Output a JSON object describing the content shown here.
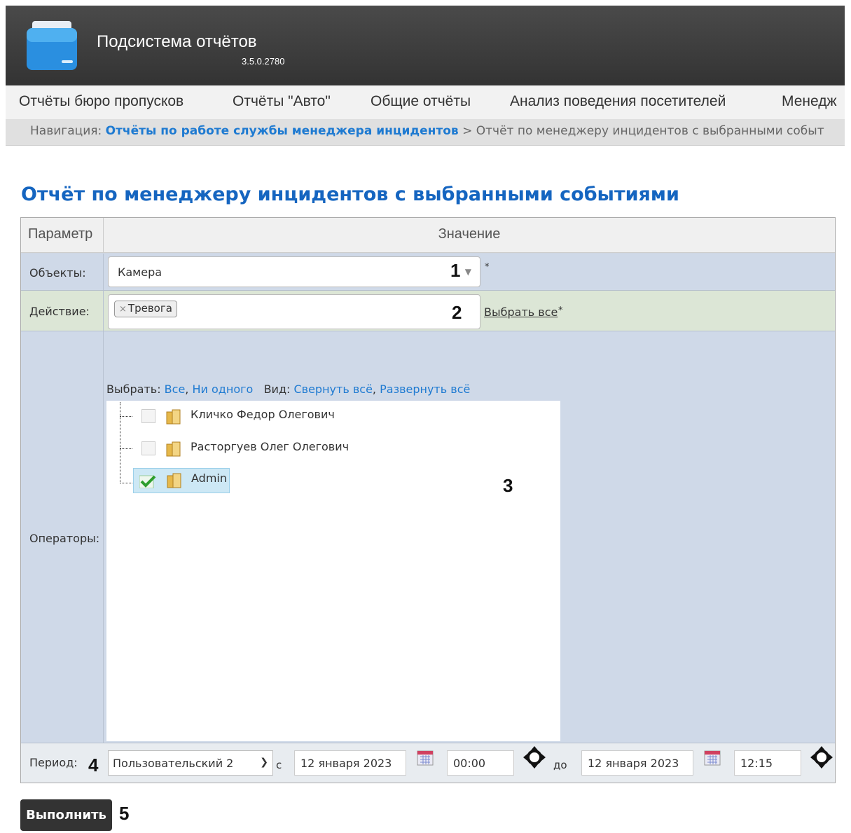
{
  "app": {
    "title": "Подсистема отчётов",
    "version": "3.5.0.2780"
  },
  "menu": [
    "Отчёты бюро пропусков",
    "Отчёты \"Авто\"",
    "Общие отчёты",
    "Анализ поведения посетителей",
    "Менедж"
  ],
  "breadcrumb": {
    "prefix": "Навигация:",
    "link": "Отчёты по работе службы менеджера инцидентов",
    "separator": ">",
    "current": "Отчёт по менеджеру инцидентов с выбранными событ"
  },
  "page_title": "Отчёт по менеджеру инцидентов с выбранными событиями",
  "table": {
    "header_param": "Параметр",
    "header_value": "Значение",
    "objects": {
      "label": "Объекты:",
      "value": "Камера",
      "required": "*",
      "annotation": "1"
    },
    "action": {
      "label": "Действие:",
      "tag": "Тревога",
      "tag_remove": "×",
      "select_all": "Выбрать все",
      "required": "*",
      "annotation": "2"
    },
    "operators": {
      "label": "Операторы:",
      "toolbar": {
        "select_prefix": "Выбрать:",
        "all": "Все",
        "comma": ",",
        "none": "Ни одного",
        "view_prefix": "Вид:",
        "collapse": "Свернуть всё",
        "expand": "Развернуть всё"
      },
      "nodes": [
        {
          "label": "Кличко Федор Олегович",
          "checked": false
        },
        {
          "label": "Расторгуев Олег Олегович",
          "checked": false
        },
        {
          "label": "Admin",
          "checked": true
        }
      ],
      "annotation": "3"
    },
    "period": {
      "label": "Период:",
      "annotation": "4",
      "preset": "Пользовательский 2",
      "from_label": "с",
      "from_date": "12 января 2023",
      "from_time": "00:00",
      "to_label": "до",
      "to_date": "12 января 2023",
      "to_time": "12:15"
    }
  },
  "run_button": {
    "label": "Выполнить",
    "annotation": "5"
  },
  "colors": {
    "header_bg": "#3a3a3a",
    "link": "#1e7ad1",
    "title": "#1565c0",
    "button_bg": "#333333"
  }
}
